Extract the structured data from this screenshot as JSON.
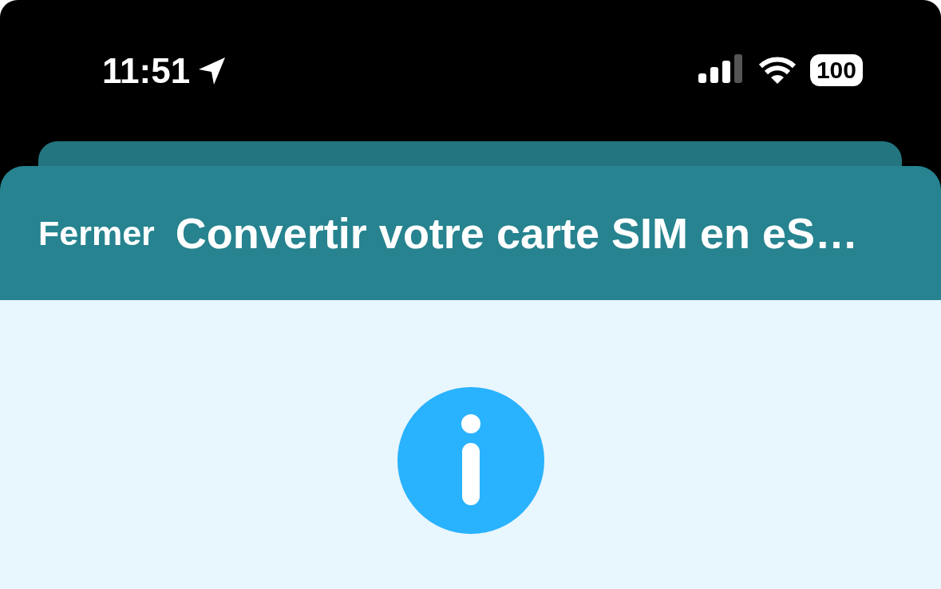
{
  "status_bar": {
    "time": "11:51",
    "battery": "100"
  },
  "header": {
    "close_label": "Fermer",
    "title": "Convertir votre carte SIM en eS…"
  }
}
